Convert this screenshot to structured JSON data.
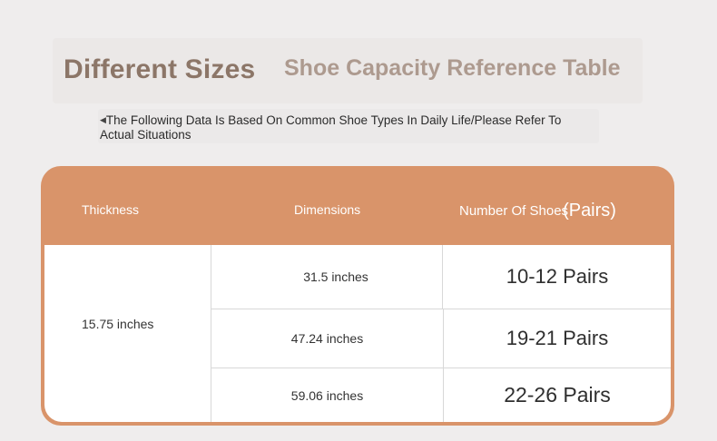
{
  "title": {
    "main": "Different Sizes",
    "sub": "Shoe Capacity Reference Table"
  },
  "note": {
    "arrow_icon": "left-triangle-icon",
    "text": "The Following Data Is Based On Common Shoe Types In Daily Life/Please Refer To Actual Situations"
  },
  "table": {
    "header_color": "#d9946a",
    "headers": {
      "thickness": "Thickness",
      "dimensions": "Dimensions",
      "number": "Number Of Shoes",
      "number_suffix": "(Pairs)"
    },
    "thickness_value": "15.75 inches",
    "rows": [
      {
        "dimension": "31.5 inches",
        "pairs": "10-12 Pairs"
      },
      {
        "dimension": "47.24 inches",
        "pairs": "19-21 Pairs"
      },
      {
        "dimension": "59.06 inches",
        "pairs": "22-26 Pairs"
      }
    ]
  }
}
